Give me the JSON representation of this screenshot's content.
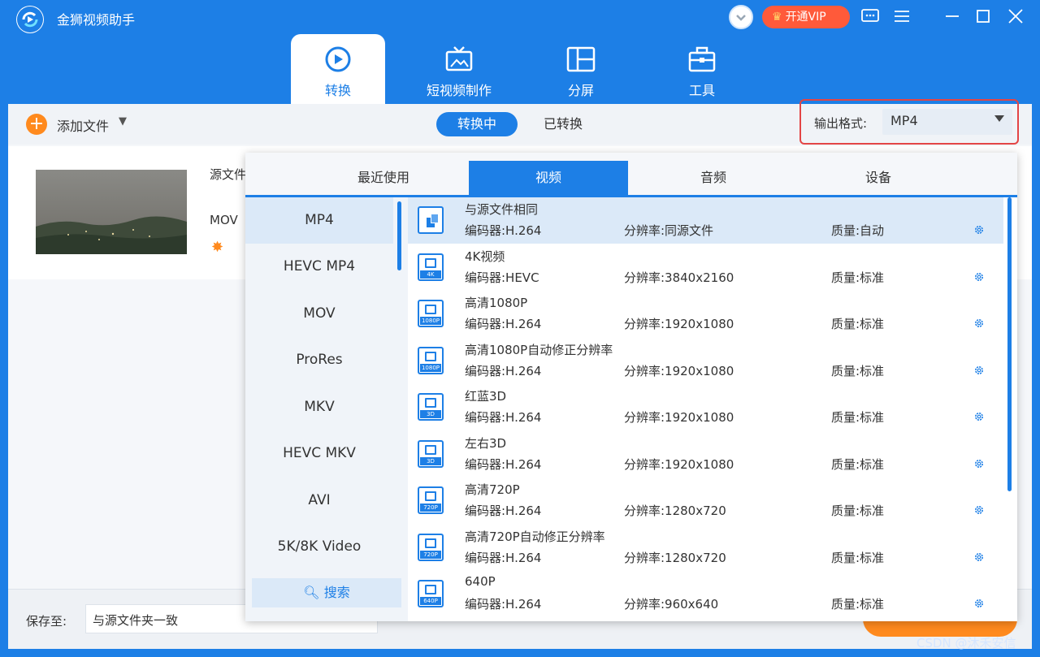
{
  "app": {
    "title": "金狮视频助手",
    "vip_label": "开通VIP"
  },
  "colors": {
    "brand": "#1d7fe6",
    "accent": "#ff8a1e",
    "vip": "#ff5a3a",
    "highlight": "#e34545"
  },
  "tabs": [
    {
      "label": "转换",
      "icon": "convert-icon"
    },
    {
      "label": "短视频制作",
      "icon": "tv-icon"
    },
    {
      "label": "分屏",
      "icon": "split-screen-icon"
    },
    {
      "label": "工具",
      "icon": "toolbox-icon"
    }
  ],
  "toolbar": {
    "add_file_label": "添加文件",
    "converting_label": "转换中",
    "converted_label": "已转换",
    "output_format_label": "输出格式:",
    "output_format_value": "MP4"
  },
  "file": {
    "source_label": "源文件",
    "format_label": "MOV"
  },
  "bottom": {
    "save_to_label": "保存至:",
    "save_to_value": "与源文件夹一致"
  },
  "dropdown": {
    "category_tabs": [
      "最近使用",
      "视频",
      "音频",
      "设备"
    ],
    "formats": [
      "MP4",
      "HEVC MP4",
      "MOV",
      "ProRes",
      "MKV",
      "HEVC MKV",
      "AVI",
      "5K/8K Video"
    ],
    "search_label": "搜索",
    "presets": [
      {
        "name": "与源文件相同",
        "encoder": "编码器:H.264",
        "resolution": "分辨率:同源文件",
        "quality": "质量:自动",
        "tag": ""
      },
      {
        "name": "4K视频",
        "encoder": "编码器:HEVC",
        "resolution": "分辨率:3840x2160",
        "quality": "质量:标准",
        "tag": "4K"
      },
      {
        "name": "高清1080P",
        "encoder": "编码器:H.264",
        "resolution": "分辨率:1920x1080",
        "quality": "质量:标准",
        "tag": "1080P"
      },
      {
        "name": "高清1080P自动修正分辨率",
        "encoder": "编码器:H.264",
        "resolution": "分辨率:1920x1080",
        "quality": "质量:标准",
        "tag": "1080P"
      },
      {
        "name": "红蓝3D",
        "encoder": "编码器:H.264",
        "resolution": "分辨率:1920x1080",
        "quality": "质量:标准",
        "tag": "3D"
      },
      {
        "name": "左右3D",
        "encoder": "编码器:H.264",
        "resolution": "分辨率:1920x1080",
        "quality": "质量:标准",
        "tag": "3D"
      },
      {
        "name": "高清720P",
        "encoder": "编码器:H.264",
        "resolution": "分辨率:1280x720",
        "quality": "质量:标准",
        "tag": "720P"
      },
      {
        "name": "高清720P自动修正分辨率",
        "encoder": "编码器:H.264",
        "resolution": "分辨率:1280x720",
        "quality": "质量:标准",
        "tag": "720P"
      },
      {
        "name": "640P",
        "encoder": "编码器:H.264",
        "resolution": "分辨率:960x640",
        "quality": "质量:标准",
        "tag": "640P"
      }
    ]
  },
  "watermark": "CSDN @沐禾安信"
}
